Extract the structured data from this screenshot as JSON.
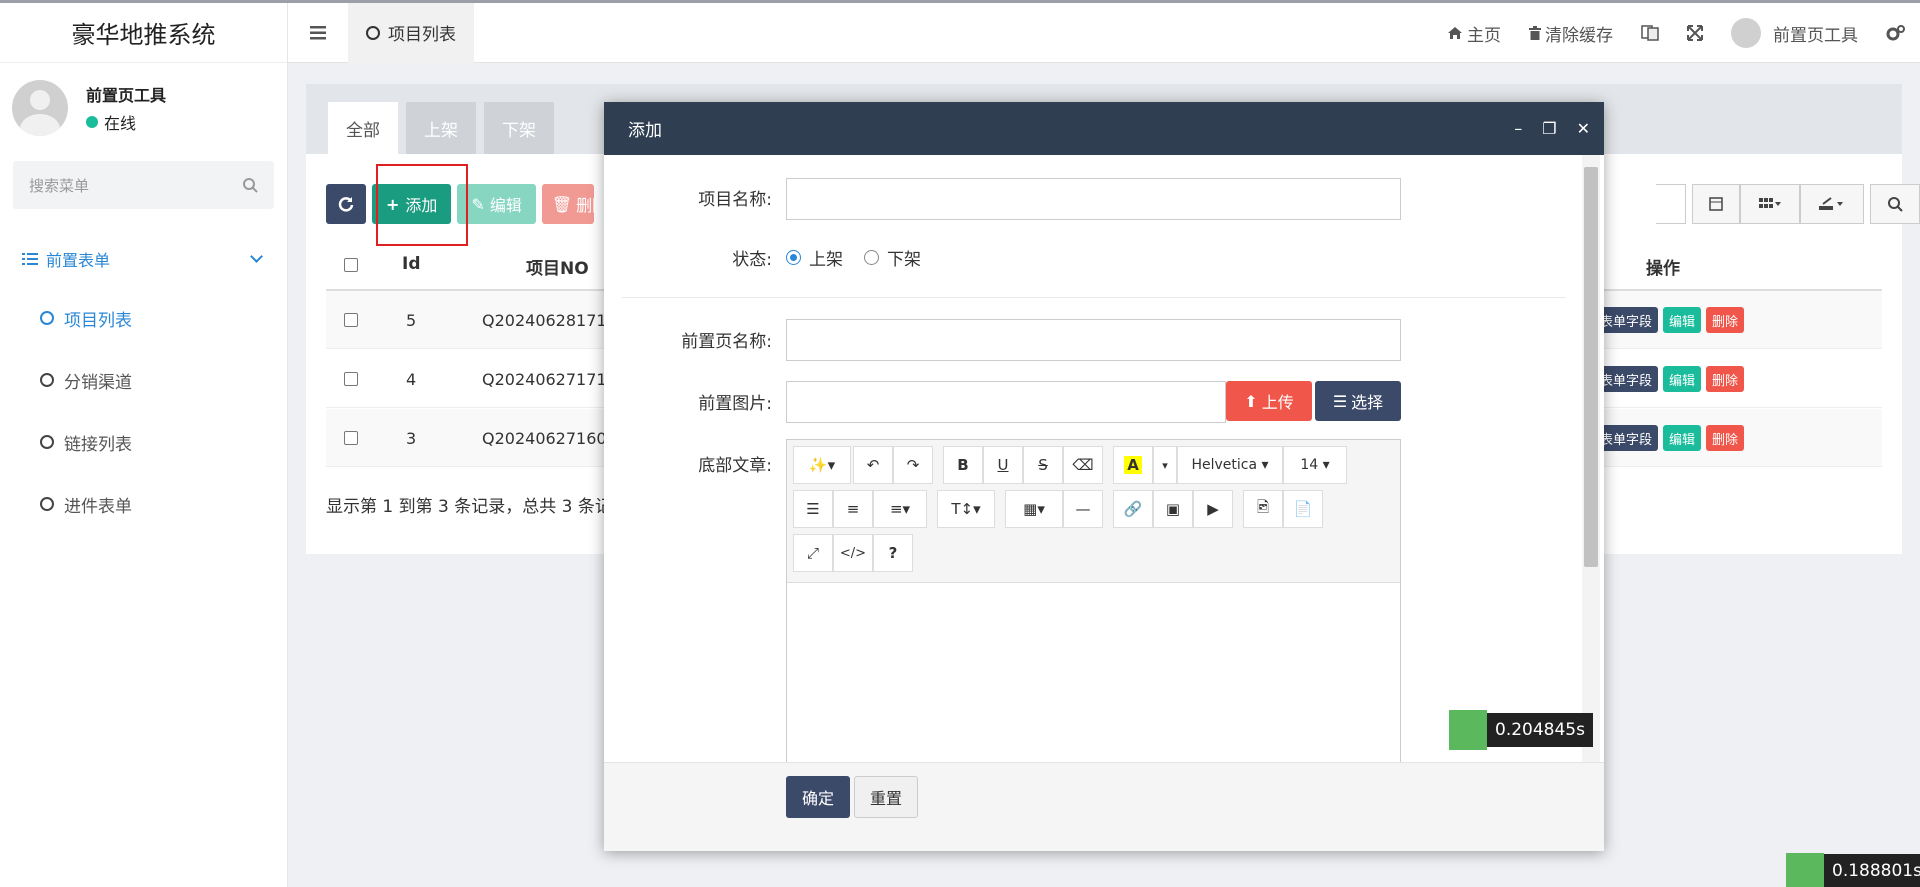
{
  "app": {
    "title": "豪华地推系统"
  },
  "user": {
    "name": "前置页工具",
    "status": "在线"
  },
  "sidebar": {
    "search_placeholder": "搜索菜单",
    "group_label": "前置表单",
    "items": [
      {
        "label": "项目列表",
        "active": true
      },
      {
        "label": "分销渠道"
      },
      {
        "label": "链接列表"
      },
      {
        "label": "进件表单"
      }
    ]
  },
  "header": {
    "tab_label": "项目列表",
    "home": "主页",
    "clear_cache": "清除缓存",
    "user_name": "前置页工具",
    "icons": [
      "hamburger-icon",
      "home-icon",
      "trash-icon",
      "translate-icon",
      "fullscreen-icon",
      "gears-icon"
    ]
  },
  "content": {
    "tabs": [
      "全部",
      "上架",
      "下架"
    ],
    "toolbar": {
      "add": "添加",
      "edit": "编辑",
      "delete": "删除"
    },
    "columns": {
      "id": "Id",
      "no": "项目NO",
      "ops": "操作"
    },
    "rows": [
      {
        "id": "5",
        "no": "Q20240628171"
      },
      {
        "id": "4",
        "no": "Q20240627171"
      },
      {
        "id": "3",
        "no": "Q20240627160"
      }
    ],
    "row_ops": {
      "fields": "表单字段",
      "edit": "编辑",
      "delete": "删除"
    },
    "pagination": "显示第 1 到第 3 条记录，总共 3 条记"
  },
  "modal": {
    "title": "添加",
    "fields": {
      "project_name": "项目名称:",
      "status": "状态:",
      "status_on": "上架",
      "status_off": "下架",
      "page_name": "前置页名称:",
      "page_image": "前置图片:",
      "bottom_text": "底部文章:"
    },
    "upload": "上传",
    "select": "选择",
    "editor": {
      "font": "Helvetica",
      "size": "14"
    },
    "confirm": "确定",
    "reset": "重置"
  },
  "timers": {
    "modal": "0.204845s",
    "page": "0.188801s"
  },
  "colors": {
    "primary": "#2a87d6",
    "dark": "#2f3e50",
    "green": "#1a9c80",
    "red": "#f0564a",
    "navy": "#3c4a6a"
  }
}
